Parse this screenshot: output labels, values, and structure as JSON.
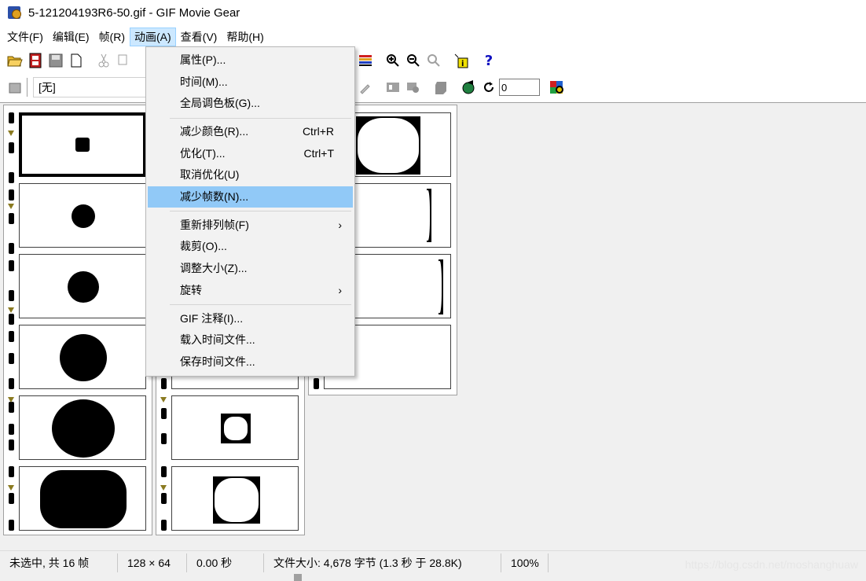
{
  "window": {
    "title": "5-121204193R6-50.gif - GIF Movie Gear"
  },
  "menubar": {
    "items": [
      "文件(F)",
      "编辑(E)",
      "帧(R)",
      "动画(A)",
      "查看(V)",
      "帮助(H)"
    ],
    "active_index": 3
  },
  "toolbar2": {
    "palette_value": "[无]",
    "loop_value": "0"
  },
  "dropdown": {
    "items": [
      {
        "label": "属性(P)...",
        "shortcut": ""
      },
      {
        "label": "时间(M)...",
        "shortcut": ""
      },
      {
        "label": "全局调色板(G)...",
        "shortcut": ""
      },
      {
        "label": "减少颜色(R)...",
        "shortcut": "Ctrl+R"
      },
      {
        "label": "优化(T)...",
        "shortcut": "Ctrl+T"
      },
      {
        "label": "取消优化(U)",
        "shortcut": ""
      },
      {
        "label": "减少帧数(N)...",
        "shortcut": "",
        "highlighted": true
      },
      {
        "label": "重新排列帧(F)",
        "submenu": true
      },
      {
        "label": "裁剪(O)...",
        "shortcut": ""
      },
      {
        "label": "调整大小(Z)...",
        "shortcut": ""
      },
      {
        "label": "旋转",
        "submenu": true
      },
      {
        "label": "GIF 注释(I)...",
        "shortcut": ""
      },
      {
        "label": "载入时间文件...",
        "shortcut": ""
      },
      {
        "label": "保存时间文件...",
        "shortcut": ""
      }
    ],
    "submenu_arrow": "›"
  },
  "statusbar": {
    "selection": "未选中, 共 16 帧",
    "dimensions": "128 × 64",
    "time": "0.00 秒",
    "filesize": "文件大小: 4,678 字节  (1.3 秒 于 28.8K)",
    "zoom": "100%"
  },
  "watermark": "https://blog.csdn.net/moshanghuaw",
  "icons": {
    "help": "?",
    "loop": "loop-icon",
    "colors": {
      "accent_highlight": "#91c9f7",
      "menu_active": "#cce8ff"
    }
  }
}
